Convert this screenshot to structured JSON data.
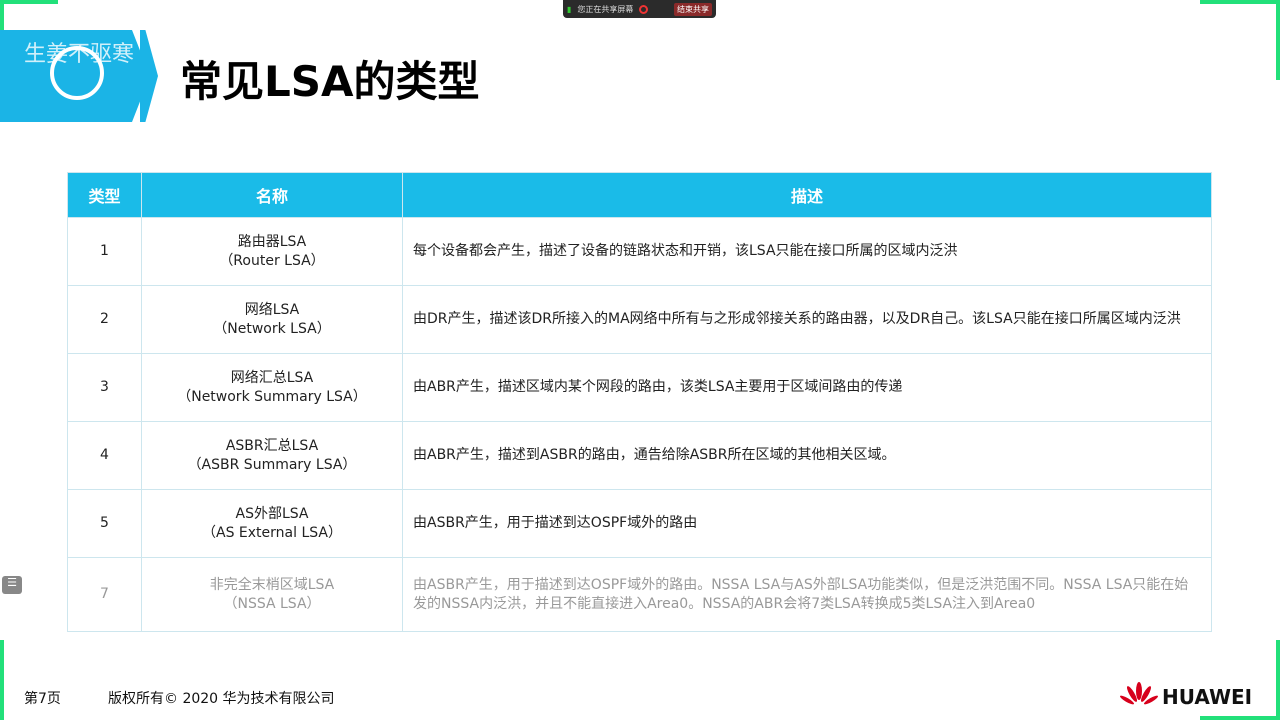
{
  "share_bar": {
    "status": "您正在共享屏幕",
    "stop": "结束共享"
  },
  "watermark": "生姜不驱寒",
  "title": "常见LSA的类型",
  "table": {
    "headers": [
      "类型",
      "名称",
      "描述"
    ],
    "rows": [
      {
        "type": "1",
        "name": "路由器LSA",
        "name_en": "（Router LSA）",
        "desc": "每个设备都会产生，描述了设备的链路状态和开销，该LSA只能在接口所属的区域内泛洪"
      },
      {
        "type": "2",
        "name": "网络LSA",
        "name_en": "（Network LSA）",
        "desc": "由DR产生，描述该DR所接入的MA网络中所有与之形成邻接关系的路由器，以及DR自己。该LSA只能在接口所属区域内泛洪"
      },
      {
        "type": "3",
        "name": "网络汇总LSA",
        "name_en": "（Network Summary LSA）",
        "desc": "由ABR产生，描述区域内某个网段的路由，该类LSA主要用于区域间路由的传递"
      },
      {
        "type": "4",
        "name": "ASBR汇总LSA",
        "name_en": "（ASBR Summary LSA）",
        "desc": "由ABR产生，描述到ASBR的路由，通告给除ASBR所在区域的其他相关区域。"
      },
      {
        "type": "5",
        "name": "AS外部LSA",
        "name_en": "（AS External LSA）",
        "desc": "由ASBR产生，用于描述到达OSPF域外的路由"
      },
      {
        "type": "7",
        "name": "非完全末梢区域LSA",
        "name_en": "（NSSA LSA）",
        "desc": "由ASBR产生，用于描述到达OSPF域外的路由。NSSA LSA与AS外部LSA功能类似，但是泛洪范围不同。NSSA LSA只能在始发的NSSA内泛洪，并且不能直接进入Area0。NSSA的ABR会将7类LSA转换成5类LSA注入到Area0"
      }
    ]
  },
  "footer": {
    "page": "第7页",
    "copyright": "版权所有© 2020 华为技术有限公司",
    "brand": "HUAWEI"
  }
}
